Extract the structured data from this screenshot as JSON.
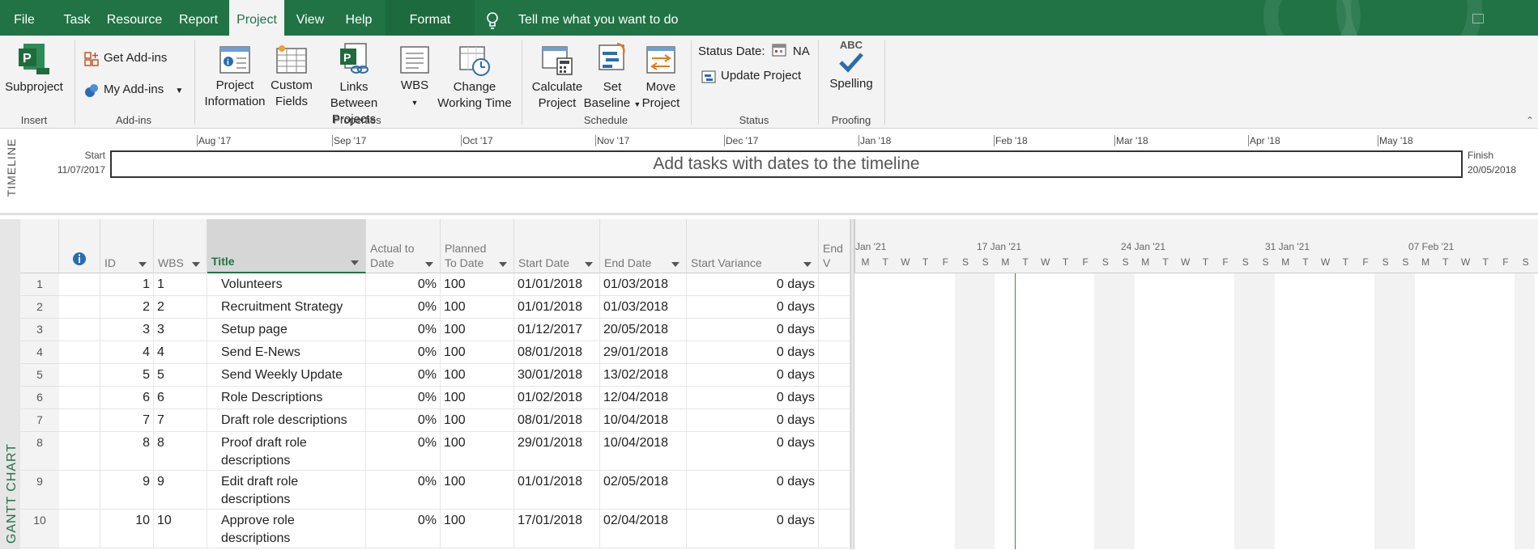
{
  "tabs": [
    "File",
    "Task",
    "Resource",
    "Report",
    "Project",
    "View",
    "Help",
    "Format"
  ],
  "tell_me": "Tell me what you want to do",
  "ribbon": {
    "insert": {
      "subproject": "Subproject",
      "group": "Insert"
    },
    "addins": {
      "get_addins": "Get Add-ins",
      "my_addins": "My Add-ins",
      "group": "Add-ins"
    },
    "properties": {
      "project_info_1": "Project",
      "project_info_2": "Information",
      "custom_fields_1": "Custom",
      "custom_fields_2": "Fields",
      "links_1": "Links Between",
      "links_2": "Projects",
      "wbs": "WBS",
      "change_wt_1": "Change",
      "change_wt_2": "Working Time",
      "group": "Properties"
    },
    "schedule": {
      "calc_1": "Calculate",
      "calc_2": "Project",
      "baseline_1": "Set",
      "baseline_2": "Baseline",
      "move_1": "Move",
      "move_2": "Project",
      "group": "Schedule"
    },
    "status": {
      "status_date_label": "Status Date:",
      "status_date_value": "NA",
      "update_project": "Update Project",
      "group": "Status"
    },
    "proofing": {
      "spelling": "Spelling",
      "abc": "ABC",
      "group": "Proofing"
    }
  },
  "timeline": {
    "side_label": "TIMELINE",
    "months": [
      "Aug '17",
      "Sep '17",
      "Oct '17",
      "Nov '17",
      "Dec '17",
      "Jan '18",
      "Feb '18",
      "Mar '18",
      "Apr '18",
      "May '18"
    ],
    "start_label": "Start",
    "start_date": "11/07/2017",
    "finish_label": "Finish",
    "finish_date": "20/05/2018",
    "placeholder": "Add tasks with dates to the timeline"
  },
  "gantt": {
    "side_label": "GANTT CHART",
    "headers": {
      "id": "ID",
      "wbs": "WBS",
      "title": "Title",
      "actual_1": "Actual to",
      "actual_2": "Date",
      "planned_1": "Planned",
      "planned_2": "To Date",
      "start": "Start Date",
      "end": "End Date",
      "start_var": "Start Variance",
      "end_var": "End V"
    },
    "rows": [
      {
        "num": "1",
        "id": "1",
        "wbs": "1",
        "title": "Volunteers",
        "actual": "0%",
        "planned": "100",
        "start": "01/01/2018",
        "end": "01/03/2018",
        "variance": "0 days"
      },
      {
        "num": "2",
        "id": "2",
        "wbs": "2",
        "title": "Recruitment Strategy",
        "actual": "0%",
        "planned": "100",
        "start": "01/01/2018",
        "end": "01/03/2018",
        "variance": "0 days"
      },
      {
        "num": "3",
        "id": "3",
        "wbs": "3",
        "title": "Setup page",
        "actual": "0%",
        "planned": "100",
        "start": "01/12/2017",
        "end": "20/05/2018",
        "variance": "0 days"
      },
      {
        "num": "4",
        "id": "4",
        "wbs": "4",
        "title": "Send E-News",
        "actual": "0%",
        "planned": "100",
        "start": "08/01/2018",
        "end": "29/01/2018",
        "variance": "0 days"
      },
      {
        "num": "5",
        "id": "5",
        "wbs": "5",
        "title": "Send Weekly Update",
        "actual": "0%",
        "planned": "100",
        "start": "30/01/2018",
        "end": "13/02/2018",
        "variance": "0 days"
      },
      {
        "num": "6",
        "id": "6",
        "wbs": "6",
        "title": "Role Descriptions",
        "actual": "0%",
        "planned": "100",
        "start": "01/02/2018",
        "end": "12/04/2018",
        "variance": "0 days"
      },
      {
        "num": "7",
        "id": "7",
        "wbs": "7",
        "title": "Draft role descriptions",
        "actual": "0%",
        "planned": "100",
        "start": "08/01/2018",
        "end": "10/04/2018",
        "variance": "0 days"
      },
      {
        "num": "8",
        "id": "8",
        "wbs": "8",
        "title": "Proof draft role descriptions",
        "actual": "0%",
        "planned": "100",
        "start": "29/01/2018",
        "end": "10/04/2018",
        "variance": "0 days"
      },
      {
        "num": "9",
        "id": "9",
        "wbs": "9",
        "title": "Edit draft role descriptions",
        "actual": "0%",
        "planned": "100",
        "start": "01/01/2018",
        "end": "02/05/2018",
        "variance": "0 days"
      },
      {
        "num": "10",
        "id": "10",
        "wbs": "10",
        "title": "Approve role descriptions",
        "actual": "0%",
        "planned": "100",
        "start": "17/01/2018",
        "end": "02/04/2018",
        "variance": "0 days"
      }
    ]
  },
  "chart_side": {
    "weeks": [
      "Jan '21",
      "17 Jan '21",
      "24 Jan '21",
      "31 Jan '21",
      "07 Feb '21"
    ],
    "days": [
      "M",
      "T",
      "W",
      "T",
      "F",
      "S",
      "S",
      "M",
      "T",
      "W",
      "T",
      "F",
      "S",
      "S",
      "M",
      "T",
      "W",
      "T",
      "F",
      "S",
      "S",
      "M",
      "T",
      "W",
      "T",
      "F",
      "S",
      "S",
      "M",
      "T",
      "W",
      "T",
      "F",
      "S"
    ]
  },
  "colors": {
    "accent": "#217346",
    "tab_active_bg": "#f3f3f3"
  }
}
